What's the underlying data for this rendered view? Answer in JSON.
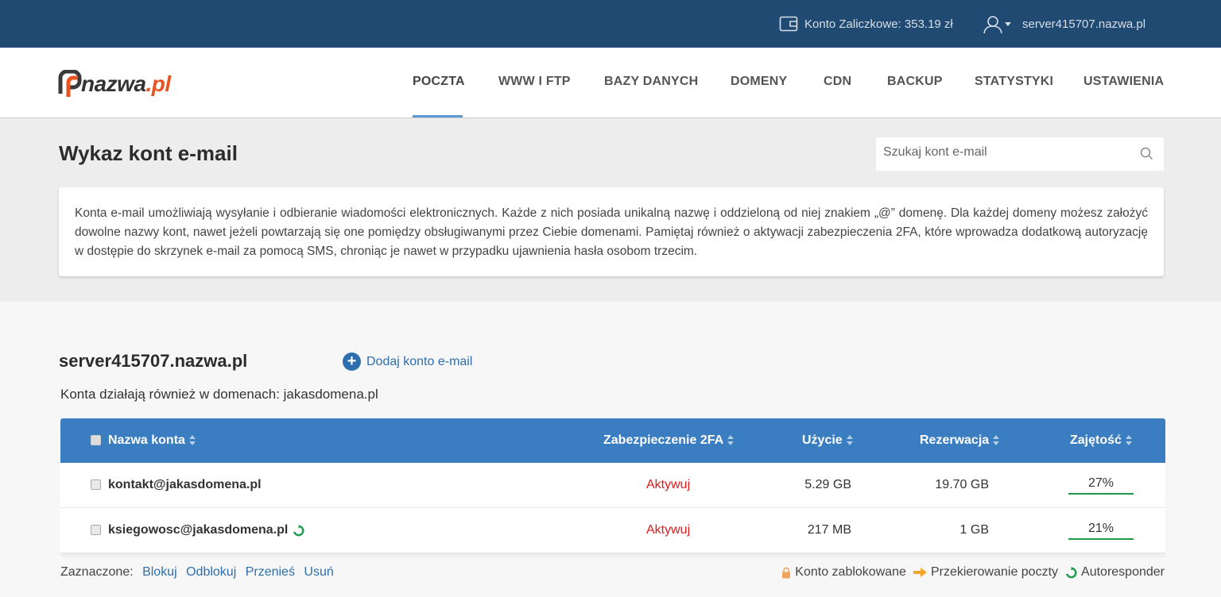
{
  "topbar": {
    "balance_label": "Konto Zaliczkowe: 353.19 zł",
    "server": "server415707.nazwa.pl"
  },
  "logo": {
    "name": "nazwa",
    "tld": ".pl"
  },
  "nav": [
    "POCZTA",
    "WWW I FTP",
    "BAZY DANYCH",
    "DOMENY",
    "CDN",
    "BACKUP",
    "STATYSTYKI",
    "USTAWIENIA"
  ],
  "page": {
    "title": "Wykaz kont e-mail",
    "search_placeholder": "Szukaj kont e-mail",
    "info": "Konta e-mail umożliwiają wysyłanie i odbieranie wiadomości elektronicznych. Każde z nich posiada unikalną nazwę i oddzieloną od niej znakiem „@” domenę. Dla każdej domeny możesz założyć dowolne nazwy kont, nawet jeżeli powtarzają się one pomiędzy obsługiwanymi przez Ciebie domenami. Pamiętaj również o aktywacji zabezpieczenia 2FA, które wprowadza dodatkową autoryzację w dostępie do skrzynek e-mail za pomocą SMS, chroniąc je nawet w przypadku ujawnienia hasła osobom trzecim."
  },
  "section": {
    "server": "server415707.nazwa.pl",
    "add_label": "Dodaj konto e-mail",
    "domains_label": "Konta działają również w domenach: jakasdomena.pl"
  },
  "table": {
    "headers": {
      "name": "Nazwa konta",
      "twofa": "Zabezpieczenie 2FA",
      "usage": "Użycie",
      "reservation": "Rezerwacja",
      "occupancy": "Zajętość"
    },
    "rows": [
      {
        "email": "kontakt@jakasdomena.pl",
        "twofa": "Aktywuj",
        "usage": "5.29 GB",
        "reservation": "19.70 GB",
        "occupancy": "27%",
        "autoresponder": false
      },
      {
        "email": "ksiegowosc@jakasdomena.pl",
        "twofa": "Aktywuj",
        "usage": "217 MB",
        "reservation": "1 GB",
        "occupancy": "21%",
        "autoresponder": true
      }
    ]
  },
  "footer": {
    "selected_label": "Zaznaczone:",
    "actions": [
      "Blokuj",
      "Odblokuj",
      "Przenieś",
      "Usuń"
    ],
    "legend": [
      "Konto zablokowane",
      "Przekierowanie poczty",
      "Autoresponder"
    ]
  },
  "colors": {
    "topbar": "#214a73",
    "table_header": "#3a7dc0",
    "link": "#2d6fad",
    "activate": "#e01b1b",
    "occupancy_bar": "#1f9b4c",
    "brand_orange": "#e8531f"
  }
}
